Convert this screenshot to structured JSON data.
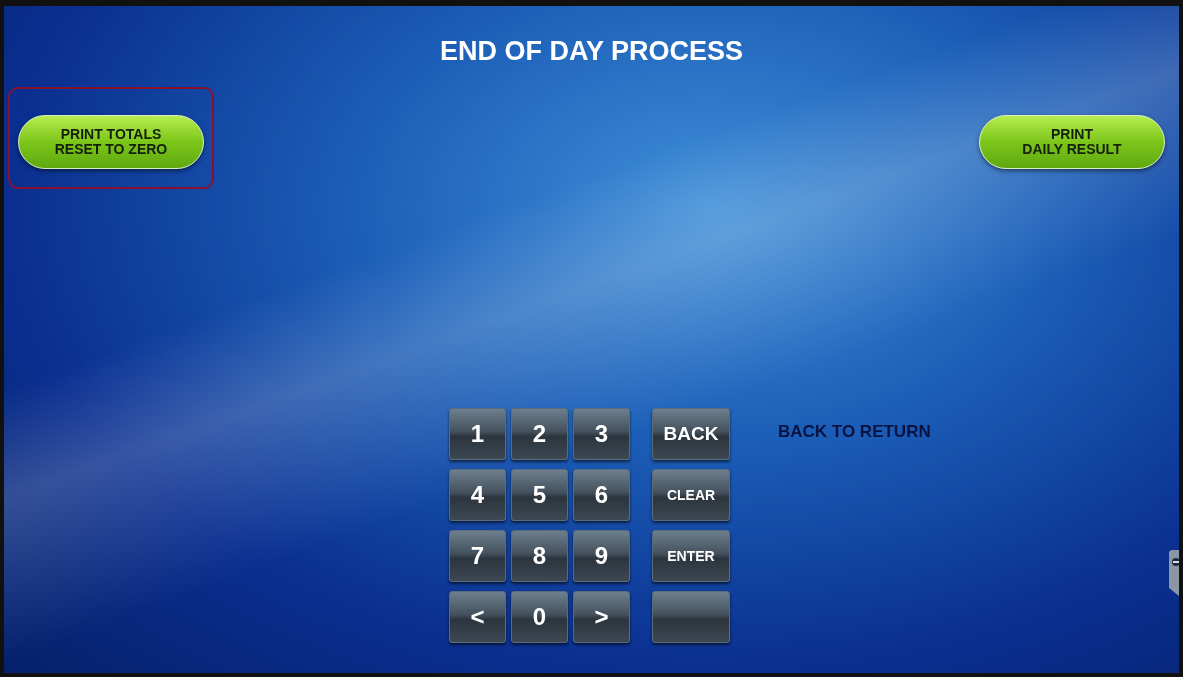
{
  "title": "END OF DAY PROCESS",
  "actions": [
    {
      "label": "PRINT TOTALS\nRESET TO ZERO",
      "selected": true
    },
    {
      "label": "PRINT\nDAILY RESULT",
      "selected": false
    }
  ],
  "keypad": {
    "rows": [
      [
        "1",
        "2",
        "3"
      ],
      [
        "4",
        "5",
        "6"
      ],
      [
        "7",
        "8",
        "9"
      ],
      [
        "<",
        "0",
        ">"
      ]
    ],
    "function_keys": [
      "BACK",
      "CLEAR",
      "ENTER"
    ]
  },
  "hint": "BACK TO RETURN"
}
